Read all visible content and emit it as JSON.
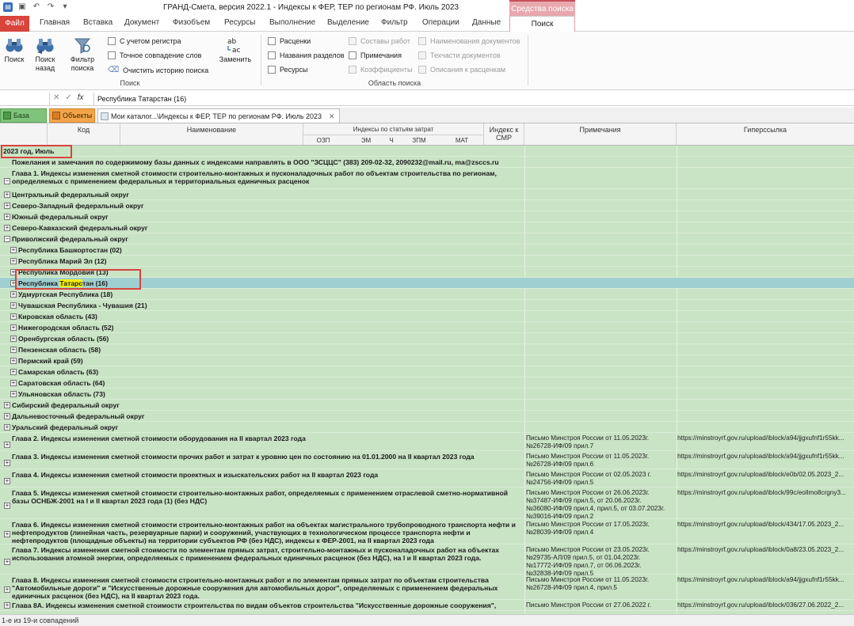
{
  "window": {
    "title": "ГРАНД-Смета, версия 2022.1 - Индексы к ФЕР, ТЕР по регионам РФ. Июль 2023",
    "context_tab_header": "Средства поиска"
  },
  "ribbon_tabs": [
    "Файл",
    "Главная",
    "Вставка",
    "Документ",
    "Физобъем",
    "Ресурсы",
    "Выполнение",
    "Выделение",
    "Фильтр",
    "Операции",
    "Данные",
    "Поиск"
  ],
  "ribbon": {
    "search": {
      "search_btn": "Поиск",
      "search_back_btn": "Поиск назад",
      "filter_btn": "Фильтр поиска",
      "replace_btn": "Заменить",
      "case_sensitive": "С учетом регистра",
      "exact_match": "Точное совпадение слов",
      "clear_history": "Очистить историю поиска",
      "group_label": "Поиск"
    },
    "area": {
      "group_label": "Область поиска",
      "items": [
        {
          "label": "Расценки",
          "disabled": false
        },
        {
          "label": "Названия разделов",
          "disabled": false
        },
        {
          "label": "Ресурсы",
          "disabled": false
        },
        {
          "label": "Составы работ",
          "disabled": true
        },
        {
          "label": "Примечания",
          "disabled": false
        },
        {
          "label": "Коэффициенты",
          "disabled": true
        },
        {
          "label": "Наименования документов",
          "disabled": true
        },
        {
          "label": "Техчасти документов",
          "disabled": true
        },
        {
          "label": "Описания к расценкам",
          "disabled": true
        }
      ]
    }
  },
  "formula_bar": {
    "value": "Республика Татарстан (16)"
  },
  "doc_tabs": {
    "base": "База",
    "objects": "Объекты",
    "catalog": "Мои каталог...\\Индексы к ФЕР, ТЕР по регионам РФ. Июль 2023"
  },
  "grid_header": {
    "code": "Код",
    "name": "Наименование",
    "indices": "Индексы по статьям затрат",
    "ozp": "ОЗП",
    "em": "ЭМ",
    "ch": "Ч",
    "zpm": "ЗПМ",
    "mat": "МАТ",
    "smr": "Индекс к СМР",
    "notes": "Примечания",
    "link": "Гиперссылка"
  },
  "rows": [
    {
      "name": "2023 год, Июль",
      "note": "",
      "link": "",
      "indent": 0,
      "toggle": ""
    },
    {
      "name": "Пожелания и замечания по содержимому базы данных с индексами направлять в ООО \"ЗСЦЦС\" (383) 209-02-32, 2090232@mail.ru, ma@zsccs.ru",
      "note": "",
      "link": "",
      "indent": 1,
      "toggle": ""
    },
    {
      "name": "Глава 1. Индексы изменения сметной стоимости строительно-монтажных и пусконаладочных работ по объектам строительства по регионам, определяемых с применением федеральных и территориальных единичных расценок",
      "note": "",
      "link": "",
      "indent": 1,
      "toggle": "−"
    },
    {
      "name": "Центральный федеральный округ",
      "note": "",
      "link": "",
      "indent": 2,
      "toggle": "+"
    },
    {
      "name": "Северо-Западный федеральный округ",
      "note": "",
      "link": "",
      "indent": 2,
      "toggle": "+"
    },
    {
      "name": "Южный федеральный округ",
      "note": "",
      "link": "",
      "indent": 2,
      "toggle": "+"
    },
    {
      "name": "Северо-Кавказский федеральный округ",
      "note": "",
      "link": "",
      "indent": 2,
      "toggle": "+"
    },
    {
      "name": "Приволжский федеральный округ",
      "note": "",
      "link": "",
      "indent": 2,
      "toggle": "−"
    },
    {
      "name": "Республика Башкортостан (02)",
      "note": "",
      "link": "",
      "indent": 3,
      "toggle": "+"
    },
    {
      "name": "Республика Марий Эл (12)",
      "note": "",
      "link": "",
      "indent": 3,
      "toggle": "+"
    },
    {
      "name": "Республика Мордовия (13)",
      "note": "",
      "link": "",
      "indent": 3,
      "toggle": "+"
    },
    {
      "name_pre": "Республика ",
      "name_hl": "Татарс",
      "name_post": "тан (16)",
      "note": "",
      "link": "",
      "indent": 3,
      "toggle": "+",
      "selected": true
    },
    {
      "name": "Удмуртская Республика (18)",
      "note": "",
      "link": "",
      "indent": 3,
      "toggle": "+"
    },
    {
      "name": "Чувашская Республика - Чувашия (21)",
      "note": "",
      "link": "",
      "indent": 3,
      "toggle": "+"
    },
    {
      "name": "Кировская область (43)",
      "note": "",
      "link": "",
      "indent": 3,
      "toggle": "+"
    },
    {
      "name": "Нижегородская область (52)",
      "note": "",
      "link": "",
      "indent": 3,
      "toggle": "+"
    },
    {
      "name": "Оренбургская область (56)",
      "note": "",
      "link": "",
      "indent": 3,
      "toggle": "+"
    },
    {
      "name": "Пензенская область (58)",
      "note": "",
      "link": "",
      "indent": 3,
      "toggle": "+"
    },
    {
      "name": "Пермский край (59)",
      "note": "",
      "link": "",
      "indent": 3,
      "toggle": "+"
    },
    {
      "name": "Самарская область (63)",
      "note": "",
      "link": "",
      "indent": 3,
      "toggle": "+"
    },
    {
      "name": "Саратовская область (64)",
      "note": "",
      "link": "",
      "indent": 3,
      "toggle": "+"
    },
    {
      "name": "Ульяновская область (73)",
      "note": "",
      "link": "",
      "indent": 3,
      "toggle": "+"
    },
    {
      "name": "Сибирский федеральный округ",
      "note": "",
      "link": "",
      "indent": 2,
      "toggle": "+"
    },
    {
      "name": "Дальневосточный федеральный округ",
      "note": "",
      "link": "",
      "indent": 2,
      "toggle": "+"
    },
    {
      "name": "Уральский федеральный округ",
      "note": "",
      "link": "",
      "indent": 2,
      "toggle": "+"
    },
    {
      "name": "Глава 2. Индексы изменения сметной стоимости оборудования на II квартал 2023 года",
      "note": "Письмо Минстроя России от 11.05.2023г.\n№26728-ИФ/09 прил.7",
      "link": "https://minstroyrf.gov.ru/upload/iblock/a94/jjgxufnf1r55kk...",
      "indent": 1,
      "toggle": "+"
    },
    {
      "name": "Глава 3. Индексы изменения сметной стоимости прочих работ и затрат к уровню цен по состоянию на 01.01.2000 на II квартал 2023 года",
      "note": "Письмо Минстроя России от 11.05.2023г.\n№26728-ИФ/09 прил.6",
      "link": "https://minstroyrf.gov.ru/upload/iblock/a94/jjgxufnf1r55kk...",
      "indent": 1,
      "toggle": "+"
    },
    {
      "name": "Глава 4. Индексы изменения сметной стоимости проектных и изыскательских работ на II квартал 2023 года",
      "note": "Письмо Минстроя России от 02.05.2023 г.\n№24756-ИФ/09 прил.5",
      "link": "https://minstroyrf.gov.ru/upload/iblock/e0b/02.05.2023_2...",
      "indent": 1,
      "toggle": "+"
    },
    {
      "name": "Глава 5. Индексы изменения сметной стоимости строительно-монтажных работ, определяемых с применением отраслевой сметно-нормативной базы ОСНБЖ-2001 на I и II квартал 2023 года (1) (без НДС)",
      "note": "Письмо Минстроя России от 26.06.2023г.\n№37487-ИФ/09 прил.5, от 20.06.2023г.\n№36080-ИФ/09 прил.4, прил.5, от 03.07.2023г.\n№39016-ИФ/09 прил.2",
      "link": "https://minstroyrf.gov.ru/upload/iblock/99c/eollmo8crgny3...",
      "indent": 1,
      "toggle": "+"
    },
    {
      "name": "Глава 6. Индексы изменения сметной стоимости строительно-монтажных работ на объектах магистрального трубопроводного транспорта нефти и нефтепродуктов (линейная часть, резервуарные парки) и сооружений, участвующих в технологическом процессе транспорта нефти и нефтепродуктов (площадные объекты) на территории субъектов РФ (без НДС), индексы к ФЕР-2001, на II квартал 2023 года",
      "note": "Письмо Минстроя России от 17.05.2023г.\n№28039-ИФ/09 прил.4",
      "link": "https://minstroyrf.gov.ru/upload/iblock/434/17.05.2023_2...",
      "indent": 1,
      "toggle": "+"
    },
    {
      "name": "Глава 7. Индексы изменения сметной стоимости по элементам прямых затрат, строительно-монтажных и пусконаладочных работ на объектах использования атомной энергии, определяемых с применением федеральных единичных расценок (без НДС), на I и II квартал 2023 года.",
      "note": "Письмо Минстроя России от 23.05.2023г.\n№29735-АЛ/09 прил.5, от 01.04.2023г.\n№17772-ИФ/09 прил.7, от 06.06.2023г.\n№32838-ИФ/09 прил.5",
      "link": "https://minstroyrf.gov.ru/upload/iblock/0a8/23.05.2023_2...",
      "indent": 1,
      "toggle": "+"
    },
    {
      "name": "Глава 8. Индексы изменения сметной стоимости строительно-монтажных работ и по элементам прямых затрат по объектам строительства \"Автомобильные дороги\" и \"Искусственные дорожные сооружения для автомобильных дорог\", определяемых с применением федеральных единичных расценок (без НДС), на II квартал 2023 года.",
      "note": "Письмо Минстроя России от 11.05.2023г.\n№26728-ИФ/09 прил.4, прил.5",
      "link": "https://minstroyrf.gov.ru/upload/iblock/a94/jjgxufnf1r55kk...",
      "indent": 1,
      "toggle": "+"
    },
    {
      "name": "Глава 8А. Индексы изменения сметной стоимости строительства по видам объектов строительства \"Искусственные дорожные сооружения\",",
      "note": "Письмо Минстроя России от 27.06.2022 г.",
      "link": "https://minstroyrf.gov.ru/upload/iblock/036/27.06.2022_2...",
      "indent": 1,
      "toggle": "+"
    }
  ],
  "status": "1-е из 19-и совпадений"
}
